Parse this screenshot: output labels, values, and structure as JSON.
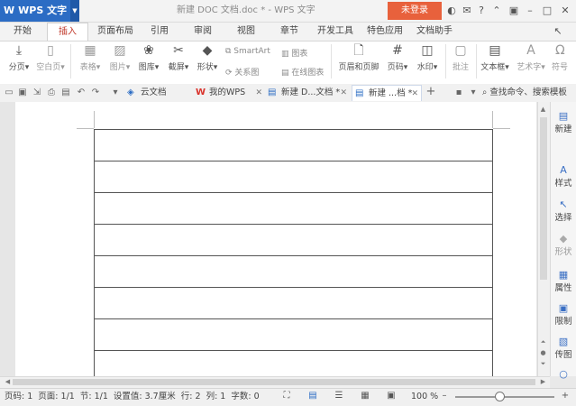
{
  "window": {
    "app_name": "WPS 文字",
    "doc_title": "新建 DOC 文档.doc * - WPS 文字",
    "login": "未登录"
  },
  "menus": [
    "开始",
    "插入",
    "页面布局",
    "引用",
    "审阅",
    "视图",
    "章节",
    "开发工具",
    "特色应用",
    "文档助手"
  ],
  "active_menu": "插入",
  "ribbon": {
    "page_break": "分页",
    "blank_page": "空白页",
    "table": "表格",
    "picture": "图片",
    "gallery": "图库",
    "screenshot": "截屏",
    "shapes": "形状",
    "smartart": "SmartArt",
    "chart": "图表",
    "relation": "关系图",
    "online_chart": "在线图表",
    "header_footer": "页眉和页脚",
    "page_number": "页码",
    "watermark": "水印",
    "comment": "批注",
    "textbox": "文本框",
    "wordart": "艺术字",
    "symbol": "符号"
  },
  "tabs": [
    {
      "label": "云文档",
      "icon": "cloud-icon"
    },
    {
      "label": "我的WPS",
      "icon": "wps-icon"
    },
    {
      "label": "新建 D...文档 *",
      "icon": "document-icon"
    },
    {
      "label": "新建 ...档 *",
      "icon": "document-icon"
    }
  ],
  "search_placeholder": "查找命令、搜索模板",
  "side_panel": [
    "新建",
    "样式",
    "选择",
    "形状",
    "属性",
    "限制",
    "传图"
  ],
  "status": {
    "text": "页码: 1  页面: 1/1  节: 1/1  设置值: 3.7厘米  行: 2  列: 1  字数: 0",
    "zoom": "100 %"
  },
  "colors": {
    "accent_blue": "#2b6cc4",
    "login_orange": "#e8613c",
    "active_menu_text": "#c0392b"
  }
}
